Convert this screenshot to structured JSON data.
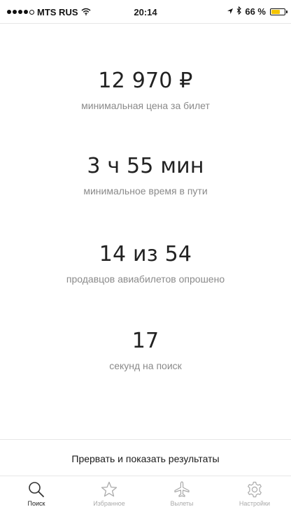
{
  "status_bar": {
    "carrier": "MTS RUS",
    "time": "20:14",
    "battery": "66 %",
    "battery_level_percent": 66,
    "battery_color": "#f4c400"
  },
  "stats": [
    {
      "value": "12 970 ₽",
      "label": "минимальная цена за билет"
    },
    {
      "value": "3 ч 55 мин",
      "label": "минимальное время в пути"
    },
    {
      "value": "14 из 54",
      "label": "продавцов авиабилетов опрошено"
    },
    {
      "value": "17",
      "label": "секунд на поиск"
    }
  ],
  "abort_label": "Прервать и показать результаты",
  "tabs": [
    {
      "label": "Поиск",
      "icon": "search-icon",
      "active": true
    },
    {
      "label": "Избранное",
      "icon": "star-icon",
      "active": false
    },
    {
      "label": "Вылеты",
      "icon": "airplane-icon",
      "active": false
    },
    {
      "label": "Настройки",
      "icon": "gear-icon",
      "active": false
    }
  ]
}
